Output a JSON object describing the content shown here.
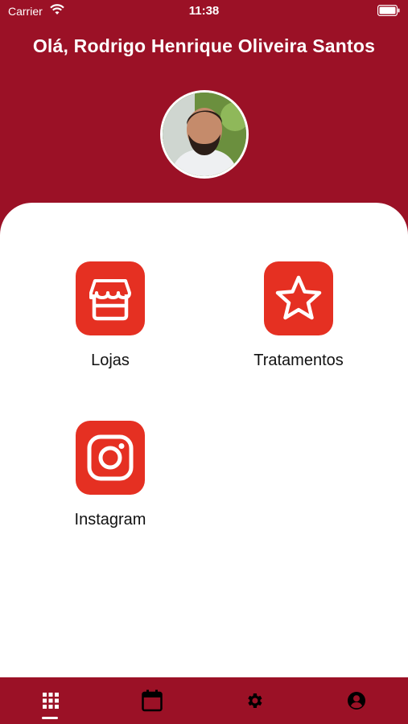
{
  "status_bar": {
    "carrier": "Carrier",
    "time": "11:38"
  },
  "header": {
    "greeting": "Olá, Rodrigo Henrique Oliveira Santos"
  },
  "menu": {
    "items": [
      {
        "label": "Lojas",
        "icon": "store-icon"
      },
      {
        "label": "Tratamentos",
        "icon": "star-icon"
      },
      {
        "label": "Instagram",
        "icon": "instagram-icon"
      }
    ]
  },
  "tab_bar": {
    "tabs": [
      {
        "icon": "grid-icon",
        "active": true
      },
      {
        "icon": "calendar-icon",
        "active": false
      },
      {
        "icon": "gear-icon",
        "active": false
      },
      {
        "icon": "account-icon",
        "active": false
      }
    ]
  },
  "colors": {
    "header_bg": "#9b1126",
    "tile_bg": "#e53022",
    "content_bg": "#ffffff"
  }
}
